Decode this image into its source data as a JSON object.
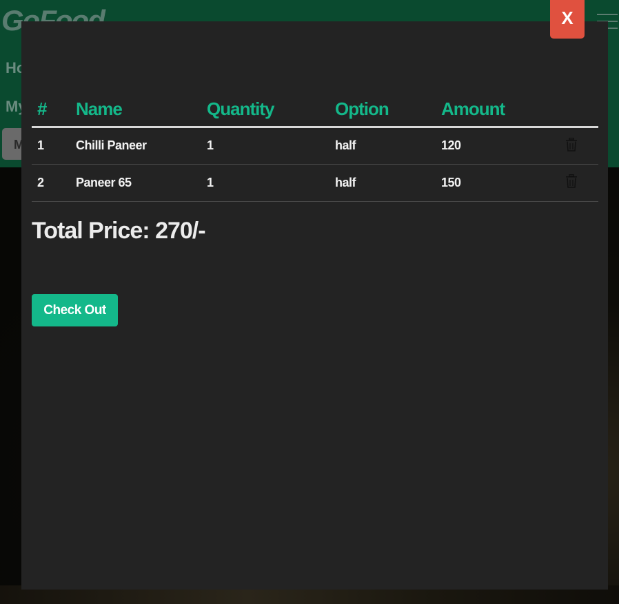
{
  "background": {
    "brand": "GoFood",
    "nav": {
      "home": "Ho",
      "my_orders": "My",
      "my_cart": "M"
    }
  },
  "modal": {
    "close_label": "X",
    "table": {
      "headers": [
        "#",
        "Name",
        "Quantity",
        "Option",
        "Amount"
      ],
      "rows": [
        {
          "index": "1",
          "name": "Chilli Paneer",
          "quantity": "1",
          "option": "half",
          "amount": "120"
        },
        {
          "index": "2",
          "name": "Paneer 65",
          "quantity": "1",
          "option": "half",
          "amount": "150"
        }
      ]
    },
    "total_price": "Total Price: 270/-",
    "checkout_label": "Check Out"
  },
  "colors": {
    "accent": "#14b88a",
    "close": "#e0513f",
    "modal_bg": "#232323",
    "navbar": "#0a4a2f"
  }
}
